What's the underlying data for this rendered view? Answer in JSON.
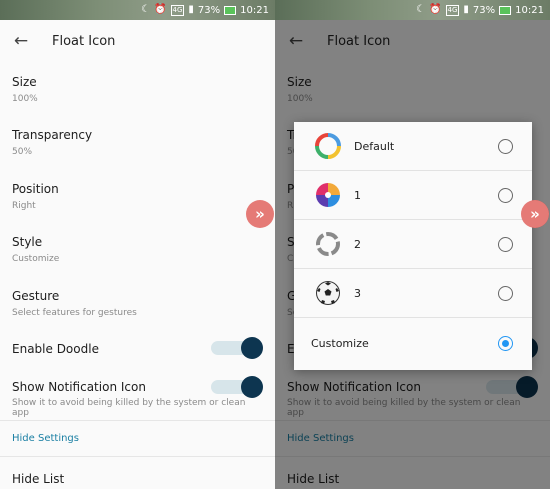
{
  "status_bar": {
    "network": "4G",
    "battery_percent": "73",
    "time": "10:21",
    "icons": [
      "moon-icon",
      "alarm-icon",
      "signal-icon",
      "battery-icon"
    ]
  },
  "app_bar": {
    "title": "Float Icon"
  },
  "settings": {
    "size": {
      "title": "Size",
      "value": "100%"
    },
    "transparency": {
      "title": "Transparency",
      "value": "50%"
    },
    "position": {
      "title": "Position",
      "value": "Right"
    },
    "style": {
      "title": "Style",
      "value": "Customize"
    },
    "gesture": {
      "title": "Gesture",
      "value": "Select features for gestures"
    },
    "enable_doodle": {
      "title": "Enable Doodle",
      "enabled": true
    },
    "show_notification_icon": {
      "title": "Show Notification Icon",
      "subtitle": "Show it to avoid being killed by the system or clean app",
      "enabled": true
    },
    "hide_settings_link": "Hide Settings",
    "hide_list": {
      "title": "Hide List"
    }
  },
  "style_dialog": {
    "options": [
      {
        "label": "Default",
        "icon": "default-ring-icon",
        "selected": false
      },
      {
        "label": "1",
        "icon": "color-pie-icon",
        "selected": false
      },
      {
        "label": "2",
        "icon": "grey-ring-icon",
        "selected": false
      },
      {
        "label": "3",
        "icon": "soccer-ball-icon",
        "selected": false
      },
      {
        "label": "Customize",
        "icon": "",
        "selected": true
      }
    ]
  },
  "float_button": {
    "icon": "double-chevron-right-icon",
    "glyph": "»"
  },
  "colors": {
    "accent_dark": "#0d3550",
    "link": "#1a7fa3",
    "float": "#e57a76",
    "radio_on": "#2196f3"
  }
}
